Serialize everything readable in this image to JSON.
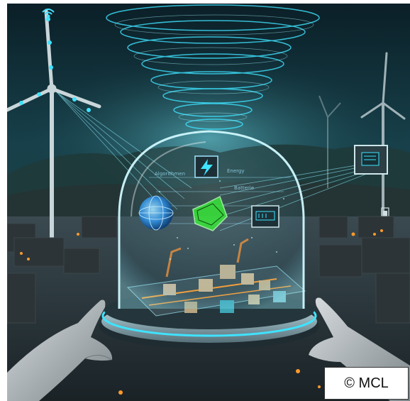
{
  "credit": {
    "text": "© MCL"
  },
  "hud": {
    "label_left": "Algorithmen",
    "label_center": "Energy",
    "label_right": "Batterie"
  },
  "colors": {
    "sky": "#0d2a33",
    "glow": "#3fe3ff",
    "cube": "#39e639",
    "sphere": "#2fa8ff",
    "accent": "#ff9a2b"
  },
  "icons": [
    "wifi-icon",
    "lightning-icon",
    "battery-icon",
    "cpu-chip-icon",
    "globe-icon",
    "cube-icon"
  ]
}
